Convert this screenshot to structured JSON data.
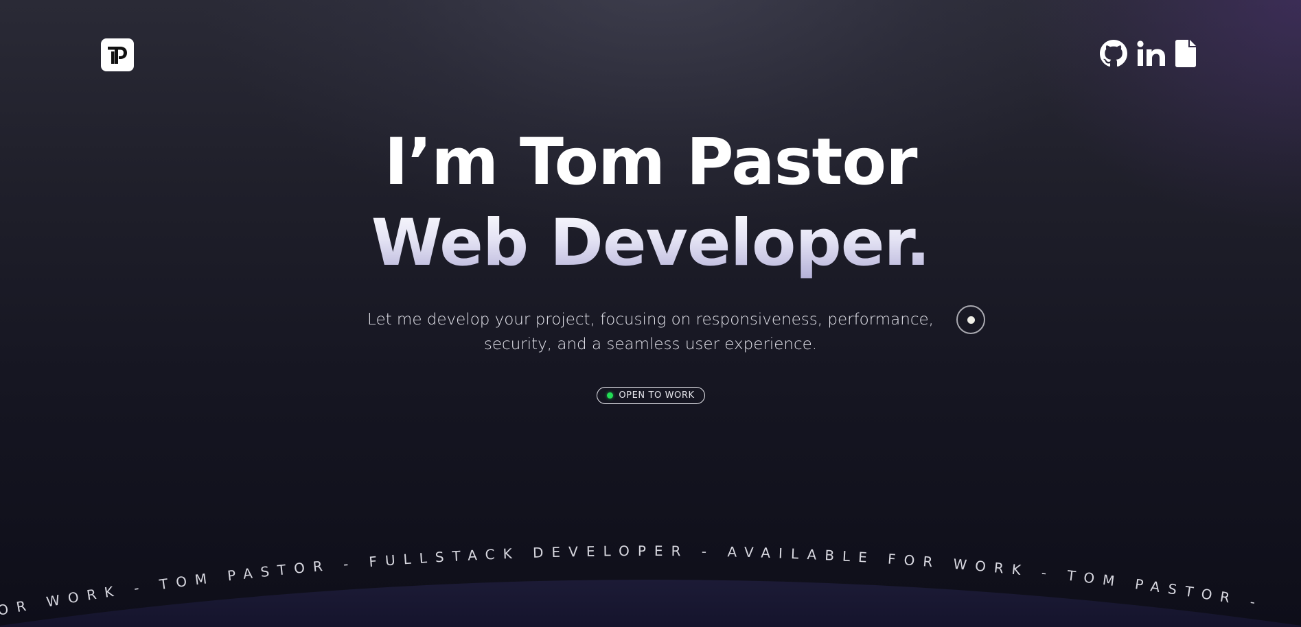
{
  "header": {
    "logo_icon": "tp-monogram-logo",
    "social_icons": [
      "github-icon",
      "linkedin-icon",
      "document-icon"
    ]
  },
  "hero": {
    "title_line1": "I’m Tom Pastor",
    "title_line2": "Web Developer.",
    "subtitle_line1": "Let me develop your project, focusing on responsiveness, performance,",
    "subtitle_line2": "security, and a seamless user experience."
  },
  "status": {
    "label": "OPEN TO WORK",
    "dot_color": "#22dd55"
  },
  "marquee": {
    "text": "OR WORK - TOM PASTOR - FULLSTACK DEVELOPER - AVAILABLE FOR WORK - TOM PASTOR -"
  },
  "colors": {
    "background_top": "#2a2a36",
    "background_bottom": "#0e0e19",
    "accent_purple": "#aeaad4",
    "arc_fill": "#181830"
  }
}
